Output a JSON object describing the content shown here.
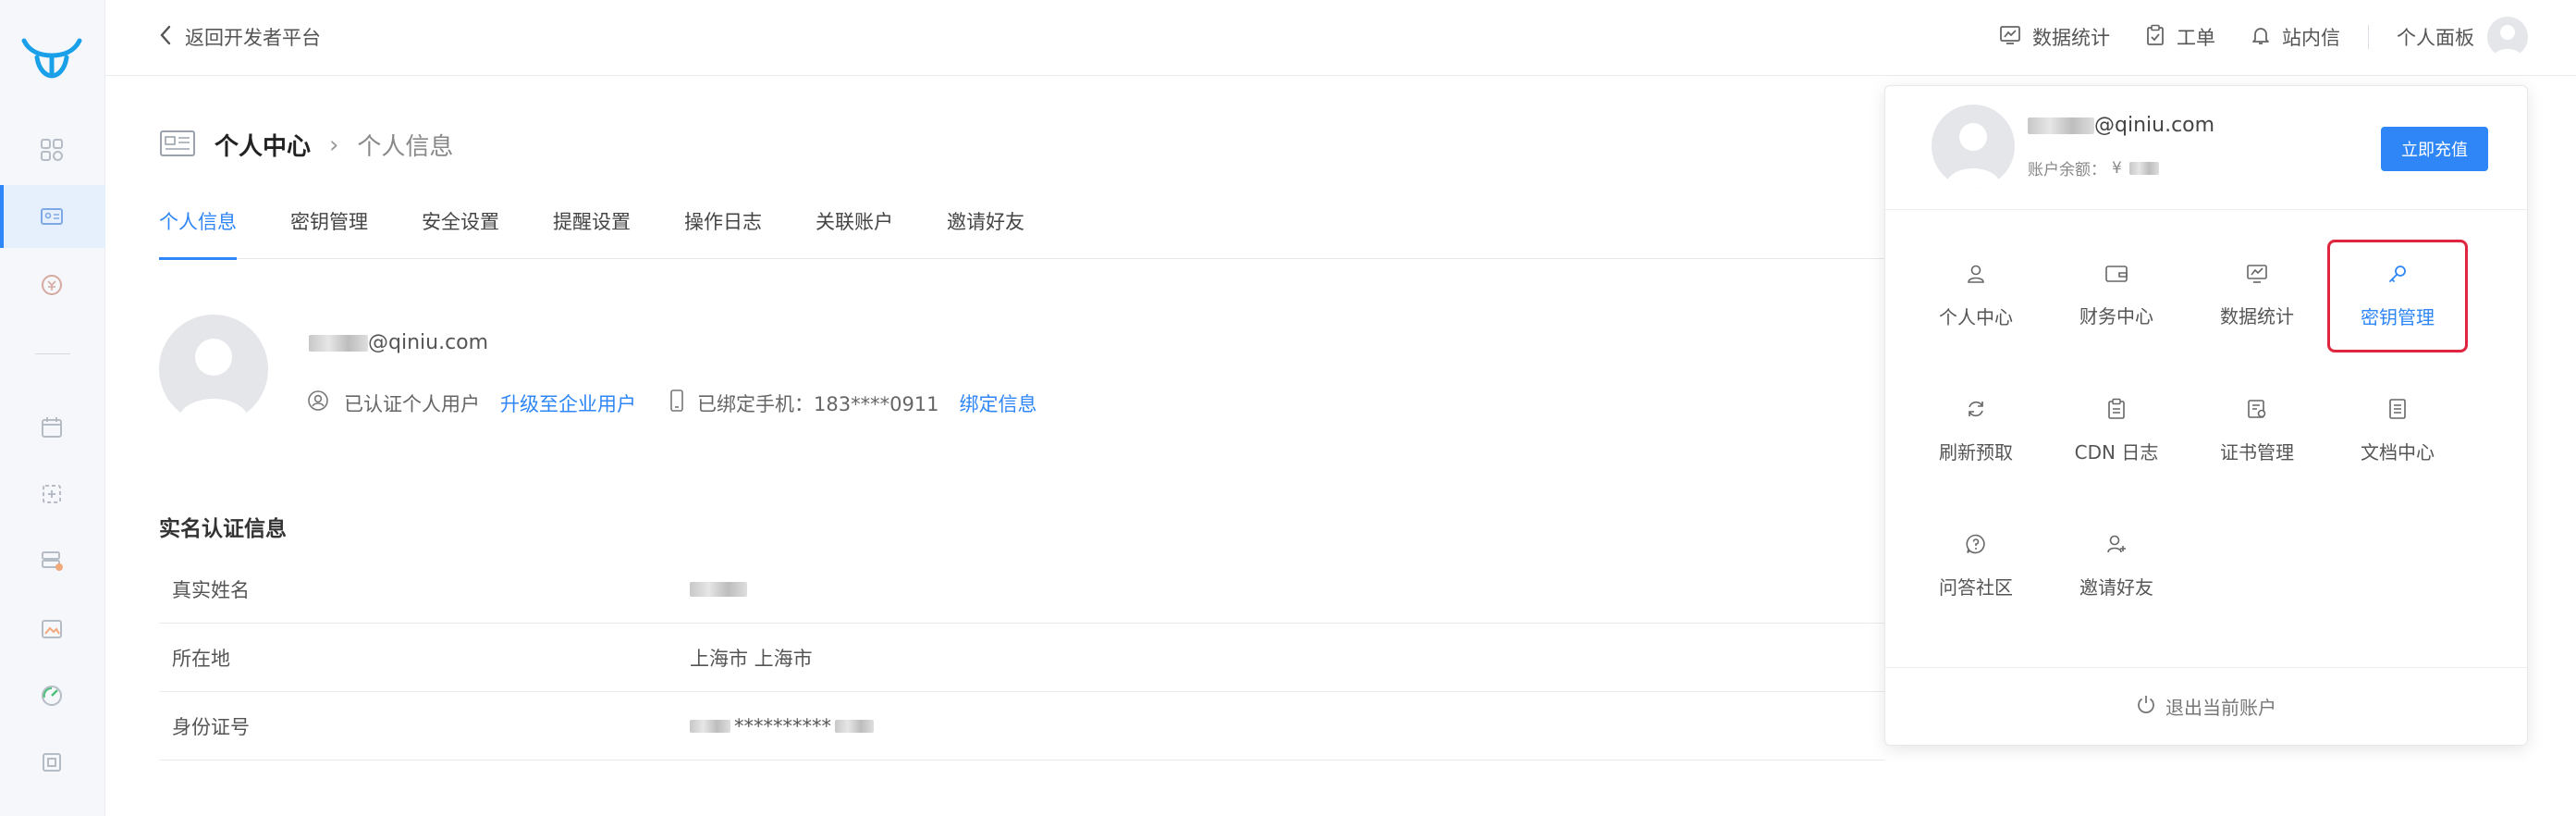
{
  "topbar": {
    "back_label": "返回开发者平台",
    "nav": [
      {
        "label": "数据统计",
        "icon": "chart-icon"
      },
      {
        "label": "工单",
        "icon": "clipboard-icon"
      },
      {
        "label": "站内信",
        "icon": "bell-icon"
      }
    ],
    "personal_panel": "个人面板"
  },
  "page": {
    "title": "个人中心",
    "subtitle": "个人信息"
  },
  "tabs": [
    "个人信息",
    "密钥管理",
    "安全设置",
    "提醒设置",
    "操作日志",
    "关联账户",
    "邀请好友"
  ],
  "profile": {
    "email_domain": "@qiniu.com",
    "verified_label": "已认证个人用户",
    "upgrade_link": "升级至企业用户",
    "phone_label": "已绑定手机：183****0911",
    "bind_link": "绑定信息"
  },
  "realname": {
    "title": "实名认证信息",
    "rows": [
      {
        "key": "真实姓名",
        "value": ""
      },
      {
        "key": "所在地",
        "value": "上海市 上海市"
      },
      {
        "key": "身份证号",
        "value": "**********"
      }
    ]
  },
  "panel": {
    "email_domain": "@qiniu.com",
    "balance_label": "账户余额：",
    "balance_currency": "¥",
    "recharge": "立即充值",
    "items": [
      {
        "label": "个人中心",
        "icon": "user-icon"
      },
      {
        "label": "财务中心",
        "icon": "wallet-icon"
      },
      {
        "label": "数据统计",
        "icon": "chart-icon"
      },
      {
        "label": "密钥管理",
        "icon": "key-icon",
        "highlight": true
      },
      {
        "label": "刷新预取",
        "icon": "refresh-icon"
      },
      {
        "label": "CDN 日志",
        "icon": "clipboard-icon"
      },
      {
        "label": "证书管理",
        "icon": "certificate-icon"
      },
      {
        "label": "文档中心",
        "icon": "document-icon"
      },
      {
        "label": "问答社区",
        "icon": "question-icon"
      },
      {
        "label": "邀请好友",
        "icon": "add-user-icon"
      }
    ],
    "logout": "退出当前账户"
  },
  "colors": {
    "accent": "#2f86f6",
    "highlight_border": "#e0263f"
  }
}
